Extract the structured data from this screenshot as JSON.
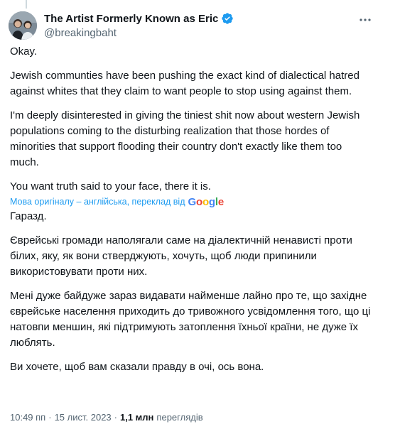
{
  "colors": {
    "text": "#0f1419",
    "secondary": "#536471",
    "link": "#1d9bf0",
    "verified": "#1d9bf0"
  },
  "author": {
    "name": "The Artist Formerly Known as Eric",
    "handle": "@breakingbaht",
    "verified_icon": "verified-badge-icon",
    "more_icon": "more-options-icon"
  },
  "original": [
    "Okay.",
    "Jewish communties have been pushing the exact kind of dialectical hatred against whites that they claim to want people to stop using against them.",
    "I'm deeply disinterested in giving the tiniest shit now about western Jewish populations coming to the disturbing realization that those hordes of minorities that support flooding their country don't exactly like them too much.",
    "You want truth said to your face, there it is."
  ],
  "translation_note": {
    "text": "Мова оригіналу – англійська, переклад від",
    "provider": "Google"
  },
  "translated": [
    "Гаразд.",
    "Єврейські громади наполягали саме на діалектичній ненависті проти білих, яку, як вони стверджують, хочуть, щоб люди припинили використовувати проти них.",
    "Мені дуже байдуже зараз видавати найменше лайно про те, що західне єврейське населення приходить до тривожного усвідомлення того, що ці натовпи меншин, які підтримують затоплення їхньої країни, не дуже їх люблять.",
    "Ви хочете, щоб вам сказали правду в очі, ось вона."
  ],
  "meta": {
    "time": "10:49 пп",
    "separator1": "·",
    "date": "15 лист. 2023",
    "separator2": "·",
    "views_count": "1,1 млн",
    "views_label": "переглядів"
  }
}
